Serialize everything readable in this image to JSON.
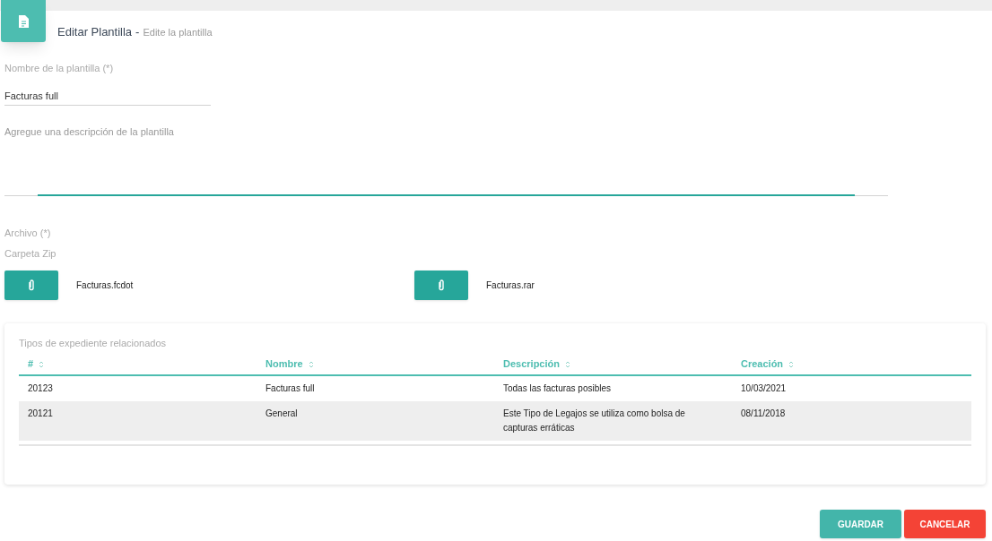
{
  "header": {
    "title": "Editar Plantilla",
    "separator": "-",
    "subtitle": "Edite la plantilla"
  },
  "name_field": {
    "label": "Nombre de la plantilla (*)",
    "value": "Facturas full"
  },
  "description_field": {
    "placeholder": "Agregue una descripción de la plantilla",
    "focused": true
  },
  "file_section": {
    "label": "Archivo (*)",
    "sublabel": "Carpeta Zip",
    "files": [
      {
        "name": "Facturas.fcdot"
      },
      {
        "name": "Facturas.rar"
      }
    ]
  },
  "table": {
    "title": "Tipos de expediente relacionados",
    "columns": [
      "#",
      "Nombre",
      "Descripción",
      "Creación"
    ],
    "rows": [
      {
        "cells": [
          "20123",
          "Facturas full",
          "Todas las facturas posibles",
          "10/03/2021"
        ],
        "selected": false
      },
      {
        "cells": [
          "20121",
          "General",
          "Este Tipo de Legajos se utiliza como bolsa de capturas erráticas",
          "08/11/2018"
        ],
        "selected": true
      }
    ]
  },
  "buttons": [
    {
      "label": "GUARDAR",
      "kind": "primary"
    },
    {
      "label": "CANCELAR",
      "kind": "danger"
    }
  ]
}
